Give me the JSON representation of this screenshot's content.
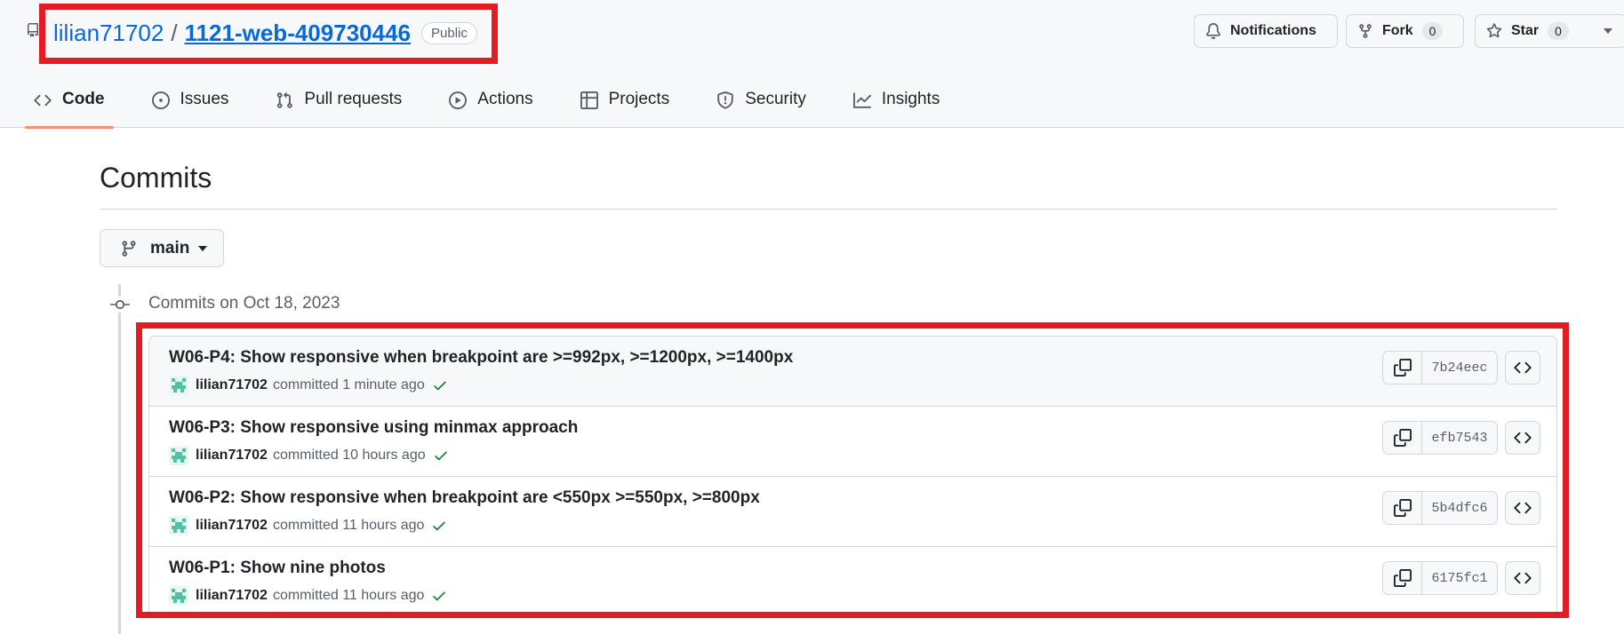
{
  "repo": {
    "owner": "lilian71702",
    "separator": "/",
    "name": "1121-web-409730446",
    "visibility": "Public"
  },
  "header_buttons": {
    "notifications": "Notifications",
    "fork": "Fork",
    "fork_count": "0",
    "star": "Star",
    "star_count": "0"
  },
  "tabs": [
    {
      "label": "Code",
      "icon": "code-icon",
      "active": true
    },
    {
      "label": "Issues",
      "icon": "issue-icon"
    },
    {
      "label": "Pull requests",
      "icon": "pull-request-icon"
    },
    {
      "label": "Actions",
      "icon": "play-icon"
    },
    {
      "label": "Projects",
      "icon": "table-icon"
    },
    {
      "label": "Security",
      "icon": "shield-icon"
    },
    {
      "label": "Insights",
      "icon": "graph-icon"
    }
  ],
  "page": {
    "title": "Commits",
    "branch": "main",
    "group_title": "Commits on Oct 18, 2023"
  },
  "commits": [
    {
      "title": "W06-P4: Show responsive when breakpoint are >=992px, >=1200px, >=1400px",
      "author": "lilian71702",
      "verb": "committed",
      "time": "1 minute ago",
      "sha": "7b24eec"
    },
    {
      "title": "W06-P3: Show responsive using minmax approach",
      "author": "lilian71702",
      "verb": "committed",
      "time": "10 hours ago",
      "sha": "efb7543"
    },
    {
      "title": "W06-P2: Show responsive when breakpoint are <550px >=550px, >=800px",
      "author": "lilian71702",
      "verb": "committed",
      "time": "11 hours ago",
      "sha": "5b4dfc6"
    },
    {
      "title": "W06-P1: Show nine photos",
      "author": "lilian71702",
      "verb": "committed",
      "time": "11 hours ago",
      "sha": "6175fc1"
    }
  ],
  "colors": {
    "link": "#0969da",
    "highlight": "#e31b23",
    "active_tab_underline": "#fd8c73",
    "success": "#1a7f37",
    "avatar": "#4fc1a6"
  }
}
